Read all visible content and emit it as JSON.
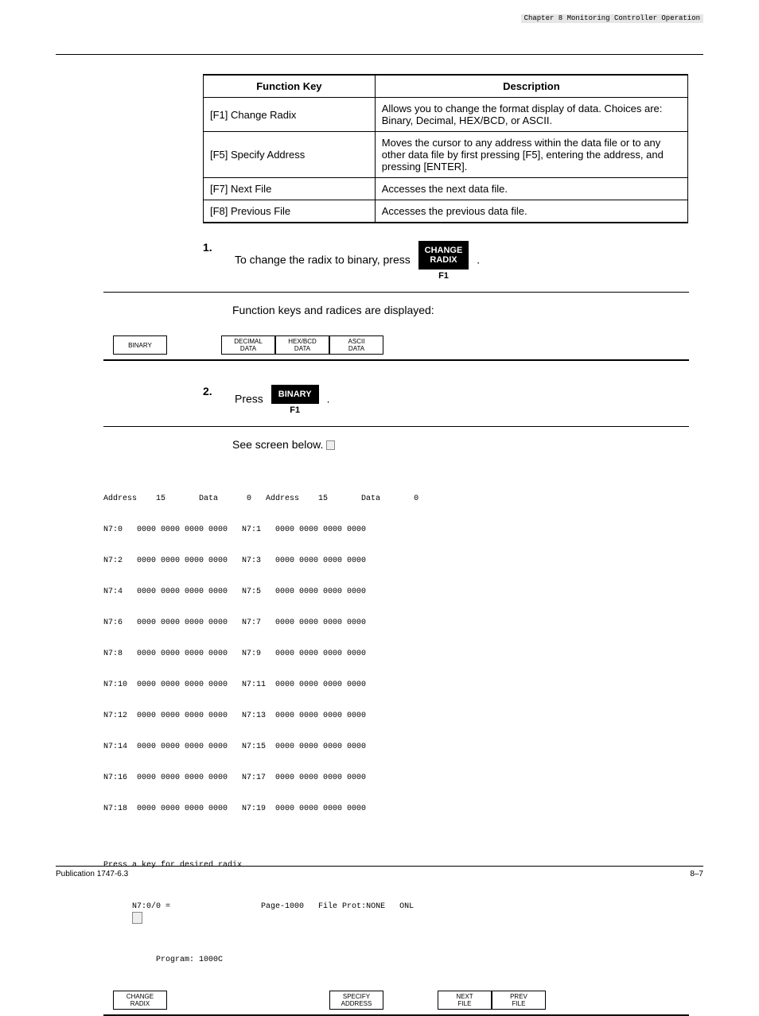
{
  "header_badge": "Chapter 8\nMonitoring Controller Operation",
  "table": {
    "h1": "Function Key",
    "h2": "Description",
    "r1c1": "[F1] Change Radix",
    "r1c2": "Allows you to change the format display of data. Choices are: Binary, Decimal, HEX/BCD, or ASCII.",
    "r2c1": "[F5] Specify Address",
    "r2c2": "Moves the cursor to any address within the data file or to any other data file by first pressing [F5], entering the address, and pressing [ENTER].",
    "r3c1": "[F7] Next File",
    "r3c2": "Accesses the next data file.",
    "r4c1": "[F8] Previous File",
    "r4c2": "Accesses the previous data file."
  },
  "step1": {
    "num": "1.",
    "pre": "To change the radix to binary, press ",
    "key1a": "CHANGE",
    "key1b": "RADIX",
    "keylabel": "F1",
    "post": "."
  },
  "step1_note": "Function keys and radices are displayed:",
  "fkeys1": {
    "f1": "BINARY",
    "f3a": "DECIMAL",
    "f3b": "DATA",
    "f4a": "HEX/BCD",
    "f4b": "DATA",
    "f5a": "ASCII",
    "f5b": "DATA"
  },
  "step2": {
    "num": "2.",
    "pre": "Press ",
    "key": "BINARY",
    "keylabel": "F1",
    "post": "."
  },
  "step2_note": "See screen below.",
  "binary": {
    "hdr": "Address    15       Data      0   Address    15       Data       0",
    "lines": [
      "N7:0   0000 0000 0000 0000   N7:1   0000 0000 0000 0000",
      "N7:2   0000 0000 0000 0000   N7:3   0000 0000 0000 0000",
      "N7:4   0000 0000 0000 0000   N7:5   0000 0000 0000 0000",
      "N7:6   0000 0000 0000 0000   N7:7   0000 0000 0000 0000",
      "N7:8   0000 0000 0000 0000   N7:9   0000 0000 0000 0000",
      "N7:10  0000 0000 0000 0000   N7:11  0000 0000 0000 0000",
      "N7:12  0000 0000 0000 0000   N7:13  0000 0000 0000 0000",
      "N7:14  0000 0000 0000 0000   N7:15  0000 0000 0000 0000",
      "N7:16  0000 0000 0000 0000   N7:17  0000 0000 0000 0000",
      "N7:18  0000 0000 0000 0000   N7:19  0000 0000 0000 0000"
    ],
    "status1": "Press a key for desired radix",
    "status2": "N7:0/0 =                   Page-1000   File Prot:NONE   ONL",
    "status3": "           Program: 1000C"
  },
  "fkeys2": {
    "f1a": "CHANGE",
    "f1b": "RADIX",
    "f5a": "SPECIFY",
    "f5b": "ADDRESS",
    "f7a": "NEXT",
    "f7b": "FILE",
    "f8a": "PREV",
    "f8b": "FILE"
  },
  "footer": {
    "left": "Publication 1747-6.3",
    "right": "8–7"
  }
}
